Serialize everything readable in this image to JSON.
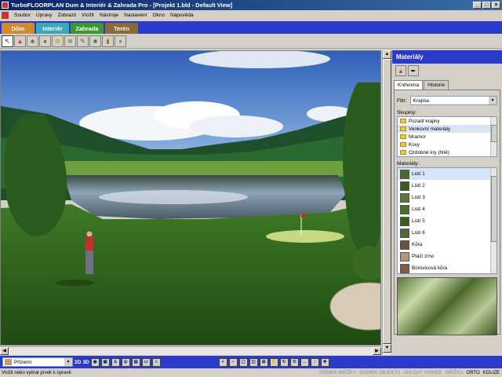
{
  "window": {
    "title": "TurboFLOORPLAN Dum & Interiér & Zahrada Pro - [Projekt 1.bld - Default View]",
    "controls": [
      "_",
      "□",
      "×"
    ]
  },
  "menu": [
    "Soubor",
    "Úpravy",
    "Zobrazit",
    "Vložit",
    "Nástroje",
    "Nastavení",
    "Okno",
    "Nápověda"
  ],
  "mode_tabs": [
    {
      "label": "Dům",
      "color": "#d08a30"
    },
    {
      "label": "Interiér",
      "color": "#3aa8b8"
    },
    {
      "label": "Zahrada",
      "color": "#3a9a30"
    },
    {
      "label": "Terén",
      "color": "#8a6a3a"
    }
  ],
  "toolbar_icons": [
    "pointer-icon",
    "paint-material-icon",
    "tree-icon",
    "shrub-icon",
    "flower-icon",
    "hedge-icon",
    "pencil-icon",
    "path-icon",
    "object-icon",
    "rock-icon"
  ],
  "panel": {
    "title": "Materiály",
    "tabs": [
      "Knihovna",
      "Historie"
    ],
    "filter_label": "Filtr:",
    "filter_value": "Krajina",
    "groups_label": "Skupiny:",
    "groups": [
      "Pozadí krajiny",
      "Venkovní materiály",
      "Mramor",
      "Kovy",
      "Ozdobné kry (hlíě)"
    ],
    "materials_label": "Materiály:",
    "materials": [
      {
        "name": "Listí 1",
        "swatch": "#4a6a28"
      },
      {
        "name": "Listí 2",
        "swatch": "#3a5a20"
      },
      {
        "name": "Listí 3",
        "swatch": "#5a7a30"
      },
      {
        "name": "Listí 4",
        "swatch": "#4a7028"
      },
      {
        "name": "Listí 5",
        "swatch": "#3a6020"
      },
      {
        "name": "Listí 6",
        "swatch": "#506a30"
      },
      {
        "name": "Kůra",
        "swatch": "#6a5040"
      },
      {
        "name": "Ptačí zrno",
        "swatch": "#b09870"
      },
      {
        "name": "Borovicová kůra",
        "swatch": "#8a5a38"
      }
    ]
  },
  "bottom": {
    "floor": "Přízemí",
    "view_buttons": [
      "2D",
      "3D"
    ]
  },
  "status": {
    "hint": "Vložit nebo vybrat prvek k úpravě",
    "flags": [
      {
        "label": "SNÍMEK MŘÍŽKY",
        "on": false
      },
      {
        "label": "SNÍMEK OBJEKTU",
        "on": false
      },
      {
        "label": "ÚHLOVÝ SNÍMEK",
        "on": false
      },
      {
        "label": "MŘÍŽKA",
        "on": false
      },
      {
        "label": "ORTO",
        "on": true
      },
      {
        "label": "KOLIZE",
        "on": true
      }
    ]
  }
}
